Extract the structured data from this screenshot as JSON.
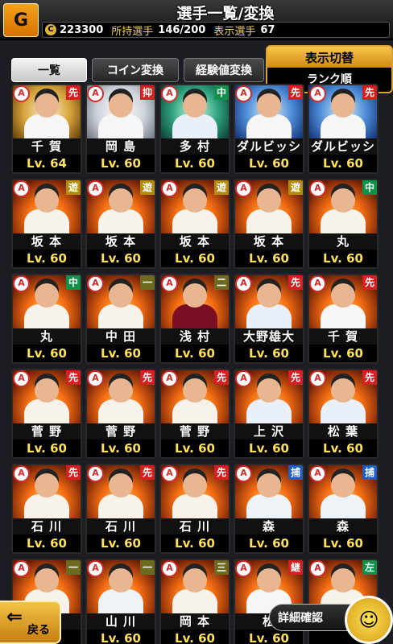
{
  "header": {
    "title": "選手一覧/変換",
    "coin_icon": "C",
    "coins": "223300",
    "owned_label": "所持選手",
    "owned_value": "146/200",
    "shown_label": "表示選手",
    "shown_value": "67"
  },
  "tabs": [
    "一覧",
    "コイン変換",
    "経験値変換"
  ],
  "switch": {
    "title": "表示切替",
    "value": "ランク順"
  },
  "cards": [
    {
      "name": "千 賀",
      "lv": "Lv. 64",
      "pos": "先",
      "pos_color": "red",
      "art": "gold",
      "uni": "hawks"
    },
    {
      "name": "岡 島",
      "lv": "Lv. 60",
      "pos": "抑",
      "pos_color": "red",
      "art": "white",
      "uni": "hawks"
    },
    {
      "name": "多 村",
      "lv": "Lv. 60",
      "pos": "中",
      "pos_color": "green",
      "art": "teal",
      "uni": "dragons"
    },
    {
      "name": "ダルビッシュ",
      "lv": "Lv. 60",
      "pos": "先",
      "pos_color": "red",
      "art": "blue",
      "uni": "hawks"
    },
    {
      "name": "ダルビッシュ",
      "lv": "Lv. 60",
      "pos": "先",
      "pos_color": "red",
      "art": "blue",
      "uni": "hawks"
    },
    {
      "name": "坂 本",
      "lv": "Lv. 60",
      "pos": "遊",
      "pos_color": "gold",
      "art": "fire",
      "uni": "giants"
    },
    {
      "name": "坂 本",
      "lv": "Lv. 60",
      "pos": "遊",
      "pos_color": "gold",
      "art": "fire",
      "uni": "giants"
    },
    {
      "name": "坂 本",
      "lv": "Lv. 60",
      "pos": "遊",
      "pos_color": "gold",
      "art": "fire",
      "uni": "giants"
    },
    {
      "name": "坂 本",
      "lv": "Lv. 60",
      "pos": "遊",
      "pos_color": "gold",
      "art": "fire",
      "uni": "giants"
    },
    {
      "name": "丸",
      "lv": "Lv. 60",
      "pos": "中",
      "pos_color": "green",
      "art": "fire",
      "uni": "giants"
    },
    {
      "name": "丸",
      "lv": "Lv. 60",
      "pos": "中",
      "pos_color": "green",
      "art": "fire",
      "uni": "giants"
    },
    {
      "name": "中 田",
      "lv": "Lv. 60",
      "pos": "一",
      "pos_color": "olive",
      "art": "fire",
      "uni": "giants"
    },
    {
      "name": "浅 村",
      "lv": "Lv. 60",
      "pos": "二",
      "pos_color": "olive",
      "art": "fire",
      "uni": "eagles"
    },
    {
      "name": "大野雄大",
      "lv": "Lv. 60",
      "pos": "先",
      "pos_color": "red",
      "art": "fire",
      "uni": "dragons"
    },
    {
      "name": "千 賀",
      "lv": "Lv. 60",
      "pos": "先",
      "pos_color": "red",
      "art": "fire",
      "uni": "hawks"
    },
    {
      "name": "菅 野",
      "lv": "Lv. 60",
      "pos": "先",
      "pos_color": "red",
      "art": "fire",
      "uni": "giants"
    },
    {
      "name": "菅 野",
      "lv": "Lv. 60",
      "pos": "先",
      "pos_color": "red",
      "art": "fire",
      "uni": "giants"
    },
    {
      "name": "菅 野",
      "lv": "Lv. 60",
      "pos": "先",
      "pos_color": "red",
      "art": "fire",
      "uni": "giants"
    },
    {
      "name": "上 沢",
      "lv": "Lv. 60",
      "pos": "先",
      "pos_color": "red",
      "art": "fire",
      "uni": "dragons"
    },
    {
      "name": "松 葉",
      "lv": "Lv. 60",
      "pos": "先",
      "pos_color": "red",
      "art": "fire",
      "uni": "dragons"
    },
    {
      "name": "石 川",
      "lv": "Lv. 60",
      "pos": "先",
      "pos_color": "red",
      "art": "fire",
      "uni": "giants"
    },
    {
      "name": "石 川",
      "lv": "Lv. 60",
      "pos": "先",
      "pos_color": "red",
      "art": "fire",
      "uni": "giants"
    },
    {
      "name": "石 川",
      "lv": "Lv. 60",
      "pos": "先",
      "pos_color": "red",
      "art": "fire",
      "uni": "giants"
    },
    {
      "name": "森",
      "lv": "Lv. 60",
      "pos": "捕",
      "pos_color": "blue",
      "art": "fire",
      "uni": "lions"
    },
    {
      "name": "森",
      "lv": "Lv. 60",
      "pos": "捕",
      "pos_color": "blue",
      "art": "fire",
      "uni": "lions"
    },
    {
      "name": "",
      "lv": "",
      "pos": "一",
      "pos_color": "olive",
      "art": "fire",
      "uni": "giants"
    },
    {
      "name": "山 川",
      "lv": "Lv. 60",
      "pos": "一",
      "pos_color": "olive",
      "art": "fire",
      "uni": "lions"
    },
    {
      "name": "岡 本",
      "lv": "Lv. 60",
      "pos": "三",
      "pos_color": "olive",
      "art": "fire",
      "uni": "giants"
    },
    {
      "name": "松",
      "lv": "Lv. 60",
      "pos": "継",
      "pos_color": "red",
      "art": "fire",
      "uni": "hawks"
    },
    {
      "name": "",
      "lv": "",
      "pos": "左",
      "pos_color": "green",
      "art": "fire",
      "uni": "giants"
    }
  ],
  "bottom": {
    "back_label": "戻る",
    "detail_label": "詳細確認",
    "detail_icon": "☺"
  }
}
